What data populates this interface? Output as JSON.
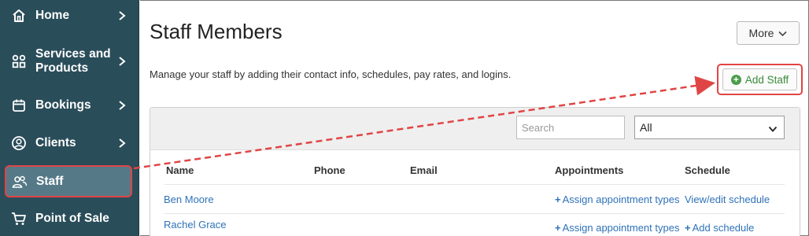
{
  "sidebar": {
    "items": [
      {
        "label": "Home",
        "icon": "home-icon"
      },
      {
        "label": "Services and Products",
        "line1": "Services and",
        "line2": "Products",
        "icon": "grid-icon"
      },
      {
        "label": "Bookings",
        "icon": "calendar-icon"
      },
      {
        "label": "Clients",
        "icon": "user-circle-icon"
      },
      {
        "label": "Staff",
        "icon": "users-icon",
        "selected": true
      },
      {
        "label": "Point of Sale",
        "icon": "cart-icon"
      }
    ]
  },
  "page": {
    "title": "Staff Members",
    "description": "Manage your staff by adding their contact info, schedules, pay rates, and logins.",
    "more_label": "More",
    "add_staff_label": "Add Staff"
  },
  "filters": {
    "search_placeholder": "Search",
    "select_value": "All"
  },
  "table": {
    "columns": [
      "Name",
      "Phone",
      "Email",
      "Appointments",
      "Schedule"
    ],
    "rows": [
      {
        "name": "Ben Moore",
        "appointments": "Assign appointment types",
        "schedule": "View/edit schedule"
      },
      {
        "name": "Rachel Grace",
        "appointments": "Assign appointment types",
        "schedule": "Add schedule"
      }
    ]
  },
  "colors": {
    "sidebar_bg": "#2a4d5a",
    "selected_bg": "#557987",
    "highlight": "#e04545",
    "link": "#2f72b8",
    "add_green": "#3c8b3c"
  }
}
